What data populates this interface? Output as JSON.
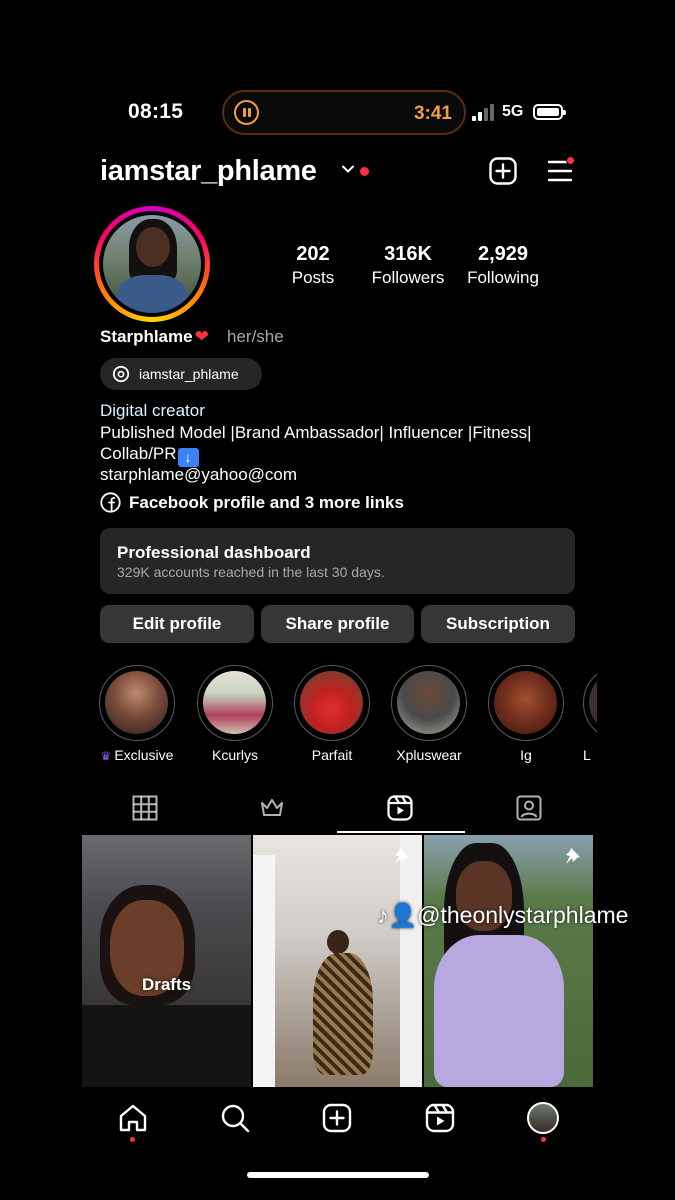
{
  "status_bar": {
    "time": "08:15",
    "timer": "3:41",
    "network": "5G"
  },
  "header": {
    "username": "iamstar_phlame"
  },
  "profile": {
    "stats": [
      {
        "value": "202",
        "label": "Posts"
      },
      {
        "value": "316K",
        "label": "Followers"
      },
      {
        "value": "2,929",
        "label": "Following"
      }
    ],
    "display_name": "Starphlame",
    "pronouns": "her/she",
    "threads_handle": "iamstar_phlame",
    "category": "Digital creator",
    "bio": "Published Model |Brand Ambassador| Influencer |Fitness| Collab/PR",
    "email": "starphlame@yahoo@com",
    "links": "Facebook profile and 3 more links"
  },
  "dashboard": {
    "title": "Professional dashboard",
    "subtitle": "329K accounts reached in the last 30 days."
  },
  "actions": {
    "edit": "Edit profile",
    "share": "Share profile",
    "subscription": "Subscription"
  },
  "highlights": [
    {
      "label": "Exclusive"
    },
    {
      "label": "Kcurlys"
    },
    {
      "label": "Parfait"
    },
    {
      "label": "Xpluswear"
    },
    {
      "label": "Ig"
    },
    {
      "label": "L"
    }
  ],
  "grid": {
    "drafts_label": "Drafts",
    "watermark": "@theonlystarphlame"
  },
  "colors": {
    "accent_red": "#ff3040",
    "timer_orange": "#f0a040",
    "card_bg": "#262626",
    "button_bg": "#363636"
  }
}
